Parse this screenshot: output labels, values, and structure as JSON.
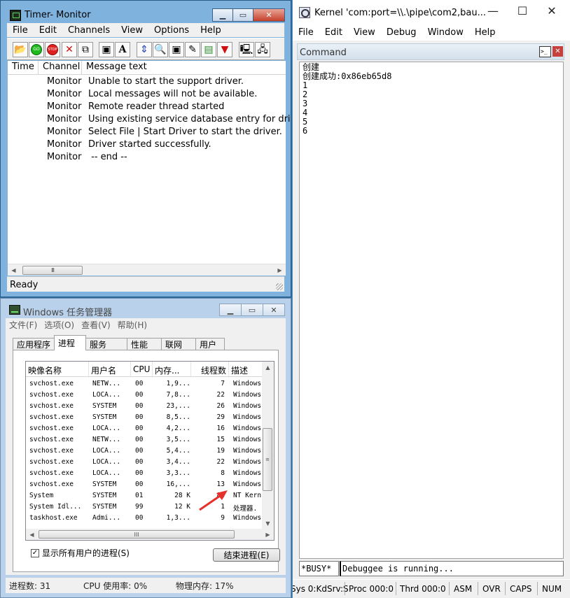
{
  "monitor": {
    "title": "Timer- Monitor",
    "menu": [
      "File",
      "Edit",
      "Channels",
      "View",
      "Options",
      "Help"
    ],
    "columns": [
      "Time",
      "Channel",
      "Message text"
    ],
    "rows": [
      {
        "channel": "Monitor",
        "message": "Unable to start the support driver."
      },
      {
        "channel": "Monitor",
        "message": "Local messages will not be available."
      },
      {
        "channel": "Monitor",
        "message": "Remote reader thread started"
      },
      {
        "channel": "Monitor",
        "message": "Using existing service database entry for driver."
      },
      {
        "channel": "Monitor",
        "message": "Select File | Start Driver to start the driver."
      },
      {
        "channel": "Monitor",
        "message": "Driver started successfully."
      },
      {
        "channel": "Monitor",
        "message": " -- end --"
      }
    ],
    "toolbar_icons": [
      "open-icon",
      "go-icon",
      "stop-icon",
      "delete-icon",
      "copy-icon",
      "save-icon",
      "font-icon",
      "scroll-icon",
      "find-icon",
      "save-log-icon",
      "edit-icon",
      "highlight-icon",
      "filter-icon",
      "monitor-local-icon",
      "monitor-remote-icon"
    ],
    "toolbar_glyphs": {
      "go": "GO",
      "stop": "STOP"
    },
    "scroll_glyph": "III",
    "status": "Ready"
  },
  "taskmgr": {
    "title": "Windows 任务管理器",
    "menu": [
      "文件(F)",
      "选项(O)",
      "查看(V)",
      "帮助(H)"
    ],
    "tabs": [
      "应用程序",
      "进程",
      "服务",
      "性能",
      "联网",
      "用户"
    ],
    "active_tab": "进程",
    "columns": [
      "映像名称",
      "用户名",
      "CPU",
      "内存...",
      "线程数",
      "描述"
    ],
    "rows": [
      {
        "name": "svchost.exe",
        "user": "NETW...",
        "cpu": "00",
        "mem": "1,9...",
        "threads": "7",
        "desc": "Windows"
      },
      {
        "name": "svchost.exe",
        "user": "LOCA...",
        "cpu": "00",
        "mem": "7,8...",
        "threads": "22",
        "desc": "Windows"
      },
      {
        "name": "svchost.exe",
        "user": "SYSTEM",
        "cpu": "00",
        "mem": "23,...",
        "threads": "26",
        "desc": "Windows"
      },
      {
        "name": "svchost.exe",
        "user": "SYSTEM",
        "cpu": "00",
        "mem": "8,5...",
        "threads": "29",
        "desc": "Windows"
      },
      {
        "name": "svchost.exe",
        "user": "LOCA...",
        "cpu": "00",
        "mem": "4,2...",
        "threads": "16",
        "desc": "Windows"
      },
      {
        "name": "svchost.exe",
        "user": "NETW...",
        "cpu": "00",
        "mem": "3,5...",
        "threads": "15",
        "desc": "Windows"
      },
      {
        "name": "svchost.exe",
        "user": "LOCA...",
        "cpu": "00",
        "mem": "5,4...",
        "threads": "19",
        "desc": "Windows"
      },
      {
        "name": "svchost.exe",
        "user": "LOCA...",
        "cpu": "00",
        "mem": "3,4...",
        "threads": "22",
        "desc": "Windows"
      },
      {
        "name": "svchost.exe",
        "user": "LOCA...",
        "cpu": "00",
        "mem": "3,3...",
        "threads": "8",
        "desc": "Windows"
      },
      {
        "name": "svchost.exe",
        "user": "SYSTEM",
        "cpu": "00",
        "mem": "16,...",
        "threads": "13",
        "desc": "Windows"
      },
      {
        "name": "System",
        "user": "SYSTEM",
        "cpu": "01",
        "mem": "28 K",
        "threads": "88",
        "desc": "NT Kern"
      },
      {
        "name": "System Idl...",
        "user": "SYSTEM",
        "cpu": "99",
        "mem": "12 K",
        "threads": "1",
        "desc": "处理器."
      },
      {
        "name": "taskhost.exe",
        "user": "Admi...",
        "cpu": "00",
        "mem": "1,3...",
        "threads": "9",
        "desc": "Windows"
      }
    ],
    "scroll_glyph": "III",
    "show_all_users": "显示所有用户的进程(S)",
    "show_all_checked": "✓",
    "end_process": "结束进程(E)",
    "status": {
      "processes": "进程数: 31",
      "cpu": "CPU 使用率: 0%",
      "memory": "物理内存: 17%"
    },
    "annotation_color": "#e8302a"
  },
  "kernel": {
    "title": "Kernel 'com:port=\\\\.\\pipe\\com2,bau...",
    "menu": [
      "File",
      "Edit",
      "View",
      "Debug",
      "Window",
      "Help"
    ],
    "command_title": "Command",
    "command_icon_glyph": ">_",
    "output": [
      "创建",
      "创建成功:0x86eb65d8",
      "1",
      "2",
      "3",
      "4",
      "5",
      "6"
    ],
    "busy": "*BUSY*",
    "input": "Debuggee is running...",
    "status": [
      "Sys 0:KdSrv:S",
      "Proc 000:0",
      "Thrd 000:0",
      "ASM",
      "OVR",
      "CAPS",
      "NUM"
    ]
  },
  "colors": {
    "desktop": "#2f6fa8",
    "monitor_frame": "#7fb2dd",
    "taskmgr_frame": "#b9d1ea"
  }
}
